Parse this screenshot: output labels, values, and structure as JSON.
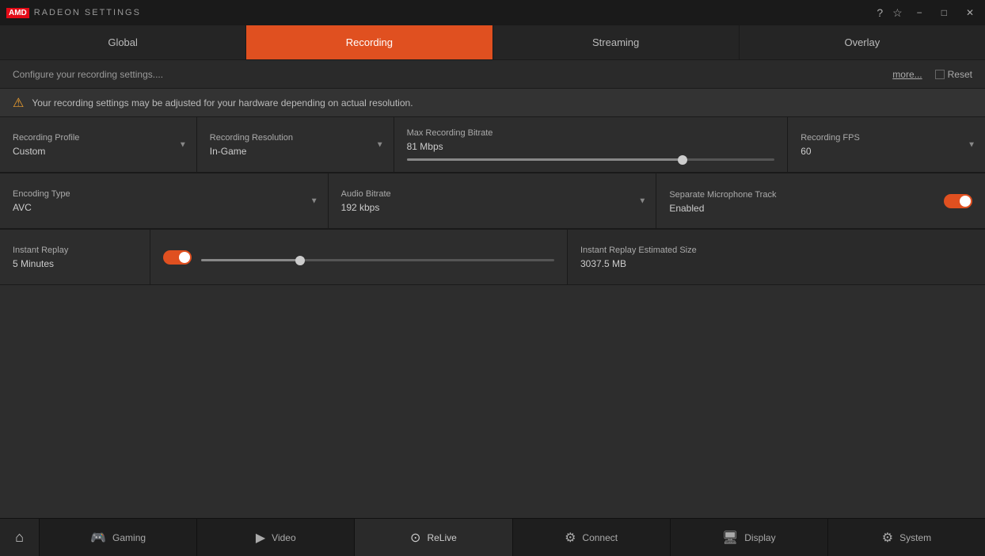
{
  "titlebar": {
    "amd_label": "AMD",
    "radeon_label": "RADEON SETTINGS",
    "help_icon": "?",
    "star_icon": "☆",
    "minimize_icon": "−",
    "maximize_icon": "□",
    "close_icon": "✕"
  },
  "tabs": [
    {
      "id": "global",
      "label": "Global",
      "active": false
    },
    {
      "id": "recording",
      "label": "Recording",
      "active": true
    },
    {
      "id": "streaming",
      "label": "Streaming",
      "active": false
    },
    {
      "id": "overlay",
      "label": "Overlay",
      "active": false
    }
  ],
  "configbar": {
    "text": "Configure your recording settings....",
    "more_label": "more...",
    "reset_label": "Reset"
  },
  "warning": {
    "text": "Your recording settings may be adjusted for your hardware depending on actual resolution."
  },
  "settings": {
    "recording_profile": {
      "label": "Recording Profile",
      "value": "Custom"
    },
    "recording_resolution": {
      "label": "Recording Resolution",
      "value": "In-Game"
    },
    "max_recording_bitrate": {
      "label": "Max Recording Bitrate",
      "value": "81 Mbps",
      "slider_percent": 75
    },
    "recording_fps": {
      "label": "Recording FPS",
      "value": "60"
    },
    "encoding_type": {
      "label": "Encoding Type",
      "value": "AVC"
    },
    "audio_bitrate": {
      "label": "Audio Bitrate",
      "value": "192 kbps"
    },
    "separate_microphone": {
      "label": "Separate Microphone Track",
      "value": "Enabled",
      "enabled": true
    },
    "instant_replay": {
      "label": "Instant Replay",
      "value": "5 Minutes",
      "enabled": true,
      "slider_percent": 28
    },
    "instant_replay_size": {
      "label": "Instant Replay Estimated Size",
      "value": "3037.5 MB"
    }
  },
  "bottomnav": {
    "home_icon": "⌂",
    "items": [
      {
        "id": "gaming",
        "label": "Gaming",
        "icon": "🎮"
      },
      {
        "id": "video",
        "label": "Video",
        "icon": "▶"
      },
      {
        "id": "relive",
        "label": "ReLive",
        "icon": "⊙",
        "active": true
      },
      {
        "id": "connect",
        "label": "Connect",
        "icon": "⚙"
      },
      {
        "id": "display",
        "label": "Display",
        "icon": "🖥"
      },
      {
        "id": "system",
        "label": "System",
        "icon": "⚙"
      }
    ]
  }
}
